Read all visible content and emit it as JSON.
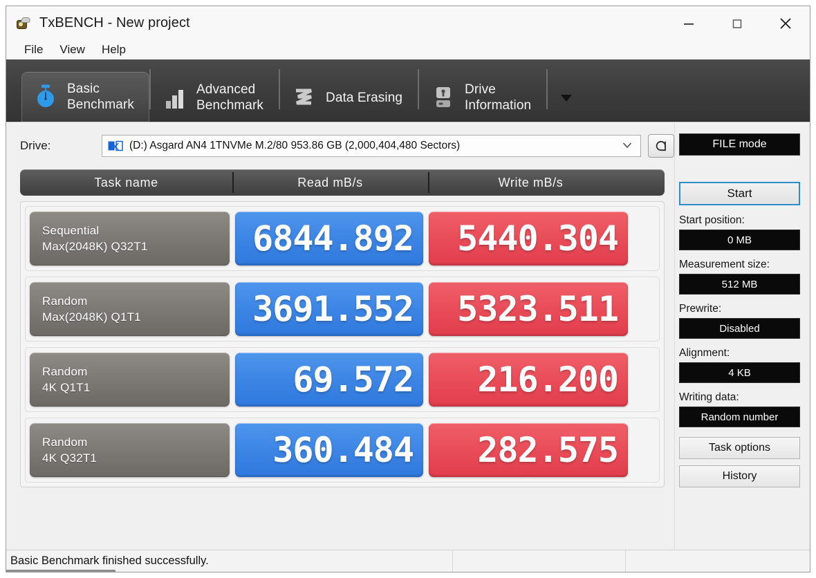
{
  "window": {
    "title": "TxBENCH - New project",
    "app_icon": "txbench-app-icon",
    "controls": {
      "minimize": "minimize-icon",
      "maximize": "maximize-icon",
      "close": "close-icon"
    }
  },
  "menu": {
    "items": [
      {
        "label": "File"
      },
      {
        "label": "View"
      },
      {
        "label": "Help"
      }
    ]
  },
  "tabs": [
    {
      "label": "Basic\nBenchmark",
      "icon": "stopwatch-icon",
      "active": true
    },
    {
      "label": "Advanced\nBenchmark",
      "icon": "bar-chart-icon",
      "active": false
    },
    {
      "label": "Data Erasing",
      "icon": "zigzag-shred-icon",
      "active": false
    },
    {
      "label": "Drive\nInformation",
      "icon": "hard-drive-info-icon",
      "active": false
    }
  ],
  "tab_overflow_icon": "chevron-down-icon",
  "drive": {
    "label": "Drive:",
    "selected": "(D:) Asgard AN4 1TNVMe M.2/80  953.86 GB (2,000,404,480 Sectors)",
    "glyph": "drive-disconnect-icon",
    "dropdown_icon": "chevron-down-icon",
    "refresh_icon": "refresh-icon"
  },
  "results": {
    "headers": [
      "Task name",
      "Read mB/s",
      "Write mB/s"
    ],
    "rows": [
      {
        "task_line1": "Sequential",
        "task_line2": "Max(2048K) Q32T1",
        "read": "6844.892",
        "write": "5440.304"
      },
      {
        "task_line1": "Random",
        "task_line2": "Max(2048K) Q1T1",
        "read": "3691.552",
        "write": "5323.511"
      },
      {
        "task_line1": "Random",
        "task_line2": "4K Q1T1",
        "read": "69.572",
        "write": "216.200"
      },
      {
        "task_line1": "Random",
        "task_line2": "4K Q32T1",
        "read": "360.484",
        "write": "282.575"
      }
    ]
  },
  "sidebar": {
    "mode_button": "FILE mode",
    "start_button": "Start",
    "fields": [
      {
        "label": "Start position:",
        "value": "0 MB"
      },
      {
        "label": "Measurement size:",
        "value": "512 MB"
      },
      {
        "label": "Prewrite:",
        "value": "Disabled"
      },
      {
        "label": "Alignment:",
        "value": "4 KB"
      },
      {
        "label": "Writing data:",
        "value": "Random number"
      }
    ],
    "task_options_button": "Task options",
    "history_button": "History"
  },
  "statusbar": {
    "message": "Basic Benchmark finished successfully.",
    "pane2": "",
    "pane3": ""
  },
  "colors": {
    "read_blue": "#3b84e4",
    "write_red": "#e84b57",
    "tabstrip": "#3e3e3e",
    "task_gray": "#7d7a76",
    "accent_focus": "#2f8ccc",
    "value_black": "#0a0a0a"
  }
}
